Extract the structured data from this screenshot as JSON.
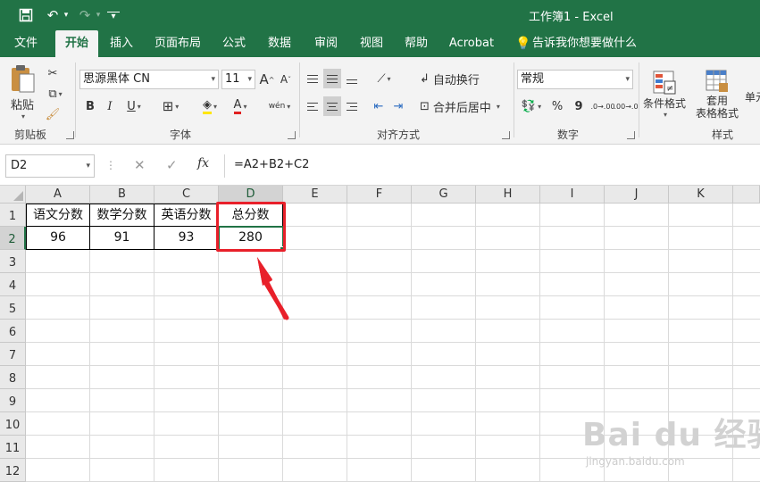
{
  "window": {
    "title": "工作簿1  -  Excel"
  },
  "quick_access": {
    "save": "🖫",
    "undo": "↶",
    "undo_caret": "▾",
    "redo": "↷",
    "redo_caret": "▾",
    "customize": "▾"
  },
  "tabs": [
    "文件",
    "开始",
    "插入",
    "页面布局",
    "公式",
    "数据",
    "审阅",
    "视图",
    "帮助",
    "Acrobat",
    "告诉我你想要做什么"
  ],
  "active_tab": "开始",
  "ribbon": {
    "clipboard": {
      "paste": "粘贴",
      "label": "剪贴板"
    },
    "font": {
      "name": "思源黑体 CN",
      "size": "11",
      "bold": "B",
      "italic": "I",
      "underline": "U",
      "grow": "A",
      "shrink": "A",
      "font_color": "A",
      "phonetic": "wén",
      "label": "字体"
    },
    "alignment": {
      "wrap": "自动换行",
      "merge": "合并后居中",
      "label": "对齐方式"
    },
    "number": {
      "format": "常规",
      "percent": "%",
      "comma": "9",
      "inc": ".0→.00",
      "dec": ".00→.0",
      "label": "数字"
    },
    "styles": {
      "conditional": "条件格式",
      "table_line1": "套用",
      "table_line2": "表格格式",
      "cell_styles": "单元",
      "label": "样式"
    }
  },
  "formula_bar": {
    "name_box": "D2",
    "cancel": "✕",
    "enter": "✓",
    "fx": "fx",
    "formula": "=A2+B2+C2"
  },
  "columns": [
    "A",
    "B",
    "C",
    "D",
    "E",
    "F",
    "G",
    "H",
    "I",
    "J",
    "K"
  ],
  "rows": [
    "1",
    "2",
    "3",
    "4",
    "5",
    "6",
    "7",
    "8",
    "9",
    "10",
    "11",
    "12"
  ],
  "cells": {
    "A1": "语文分数",
    "B1": "数学分数",
    "C1": "英语分数",
    "D1": "总分数",
    "A2": "96",
    "B2": "91",
    "C2": "93",
    "D2": "280"
  },
  "selected_cell": "D2",
  "colors": {
    "excel_green": "#217346",
    "annotation_red": "#e8202a"
  },
  "watermark": {
    "brand": "Bai du 经验",
    "url": "jingyan.baidu.com"
  }
}
